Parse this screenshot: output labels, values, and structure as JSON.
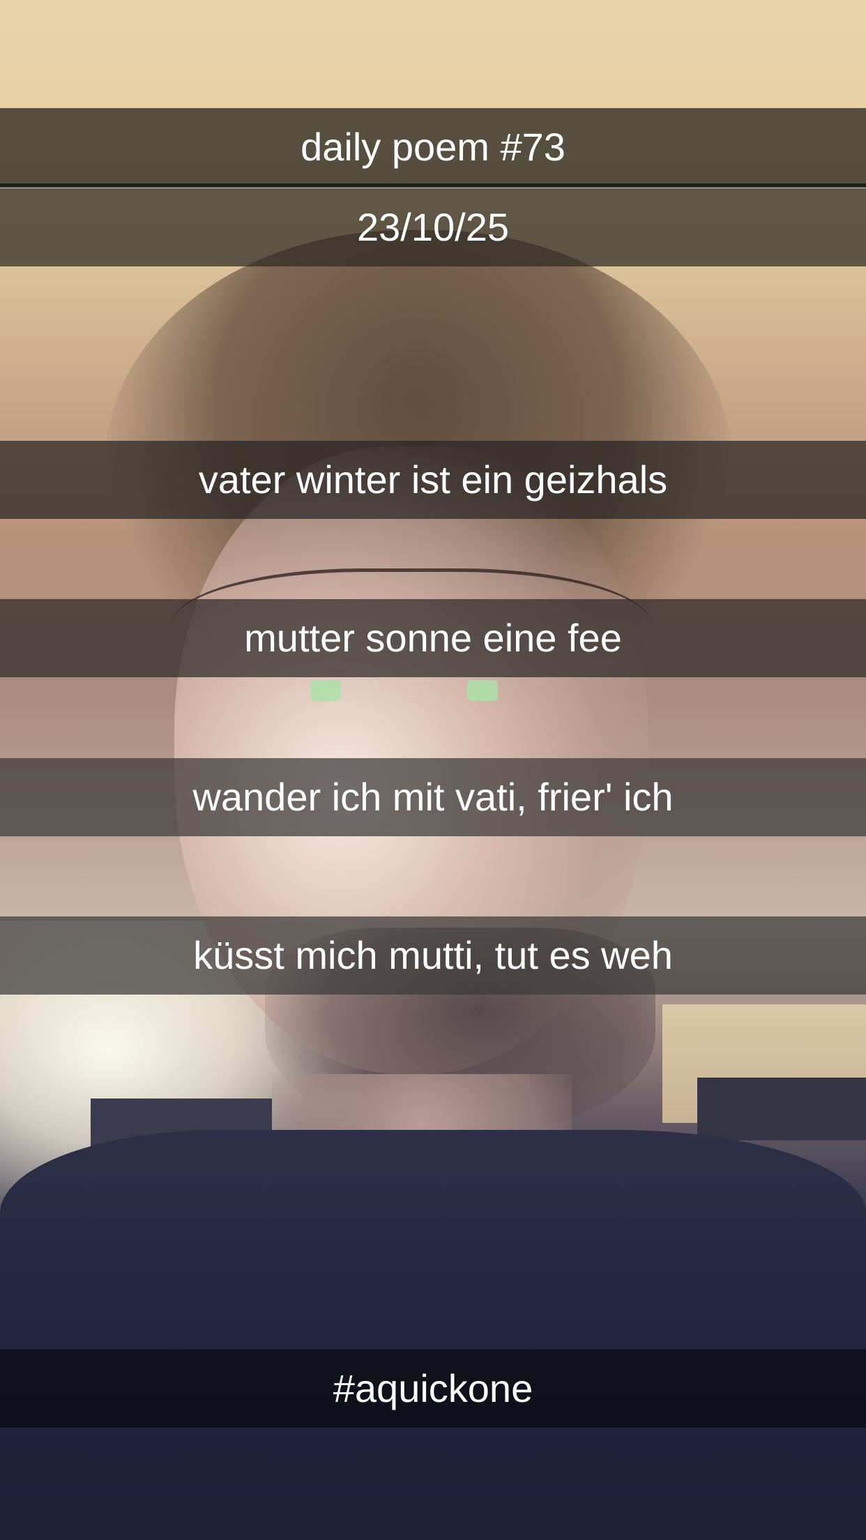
{
  "title": "daily poem #73",
  "date": "23/10/25",
  "poem_lines": [
    "vater winter ist ein geizhals",
    "mutter sonne eine fee",
    "wander ich mit vati, frier' ich",
    "küsst mich mutti, tut es weh"
  ],
  "hashtag": "#aquickone",
  "colors": {
    "caption_text": "#ffffff",
    "caption_band": "#282828"
  }
}
